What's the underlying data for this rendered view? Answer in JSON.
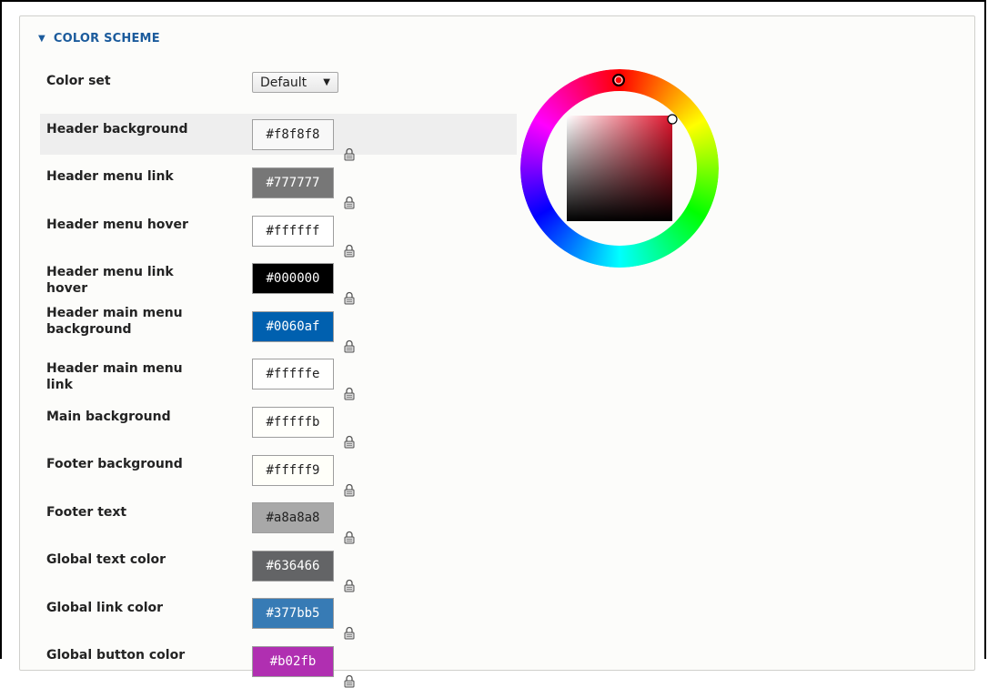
{
  "section": {
    "title": "COLOR SCHEME",
    "toggle_icon": "triangle-down"
  },
  "color_set": {
    "label": "Color set",
    "selected": "Default"
  },
  "fields": [
    {
      "label": "Header background",
      "value": "#f8f8f8",
      "bg": "#f8f8f8",
      "fg": "#222222"
    },
    {
      "label": "Header menu link",
      "value": "#777777",
      "bg": "#777777",
      "fg": "#ffffff"
    },
    {
      "label": "Header menu hover",
      "value": "#ffffff",
      "bg": "#ffffff",
      "fg": "#222222"
    },
    {
      "label": "Header menu link hover",
      "value": "#000000",
      "bg": "#000000",
      "fg": "#ffffff"
    },
    {
      "label": "Header main menu background",
      "value": "#0060af",
      "bg": "#0060af",
      "fg": "#ffffff"
    },
    {
      "label": "Header main menu link",
      "value": "#fffffe",
      "bg": "#fffffe",
      "fg": "#222222"
    },
    {
      "label": "Main background",
      "value": "#fffffb",
      "bg": "#fffffb",
      "fg": "#222222"
    },
    {
      "label": "Footer background",
      "value": "#fffff9",
      "bg": "#fffff9",
      "fg": "#222222"
    },
    {
      "label": "Footer text",
      "value": "#a8a8a8",
      "bg": "#a8a8a8",
      "fg": "#222222"
    },
    {
      "label": "Global text color",
      "value": "#636466",
      "bg": "#636466",
      "fg": "#ffffff"
    },
    {
      "label": "Global link color",
      "value": "#377bb5",
      "bg": "#377bb5",
      "fg": "#ffffff"
    },
    {
      "label": "Global button color",
      "value": "#b02fb",
      "bg": "#b02fb1",
      "fg": "#ffffff"
    }
  ],
  "picker": {
    "selected_hue_color": "#e0142c"
  }
}
